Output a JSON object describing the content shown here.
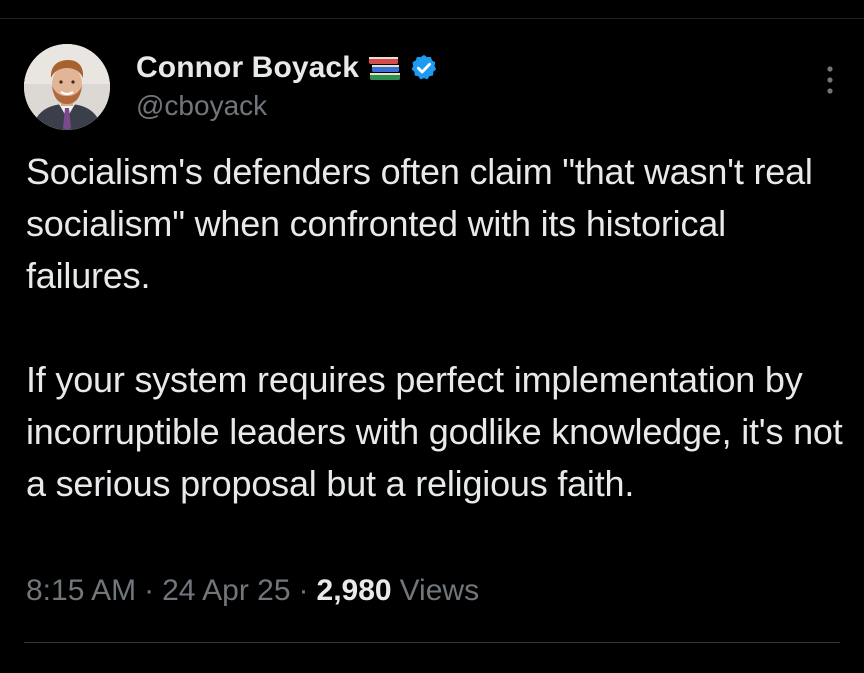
{
  "author": {
    "display_name": "Connor Boyack",
    "handle": "@cboyack",
    "badge_emoji": "books-icon",
    "verified_badge": "verified-icon",
    "verified_color": "#1d9bf0"
  },
  "tweet": {
    "text": "Socialism's defenders often claim \"that wasn't real socialism\" when confronted with its historical failures.\n\nIf your system requires perfect implementation by incorruptible leaders with godlike knowledge, it's not a serious proposal but a religious faith."
  },
  "meta": {
    "time": "8:15 AM",
    "separator": "·",
    "date": "24 Apr 25",
    "views_count": "2,980",
    "views_label": "Views"
  },
  "colors": {
    "background": "#000000",
    "text_primary": "#e7e9ea",
    "text_secondary": "#71767b",
    "divider": "#2f3336"
  }
}
